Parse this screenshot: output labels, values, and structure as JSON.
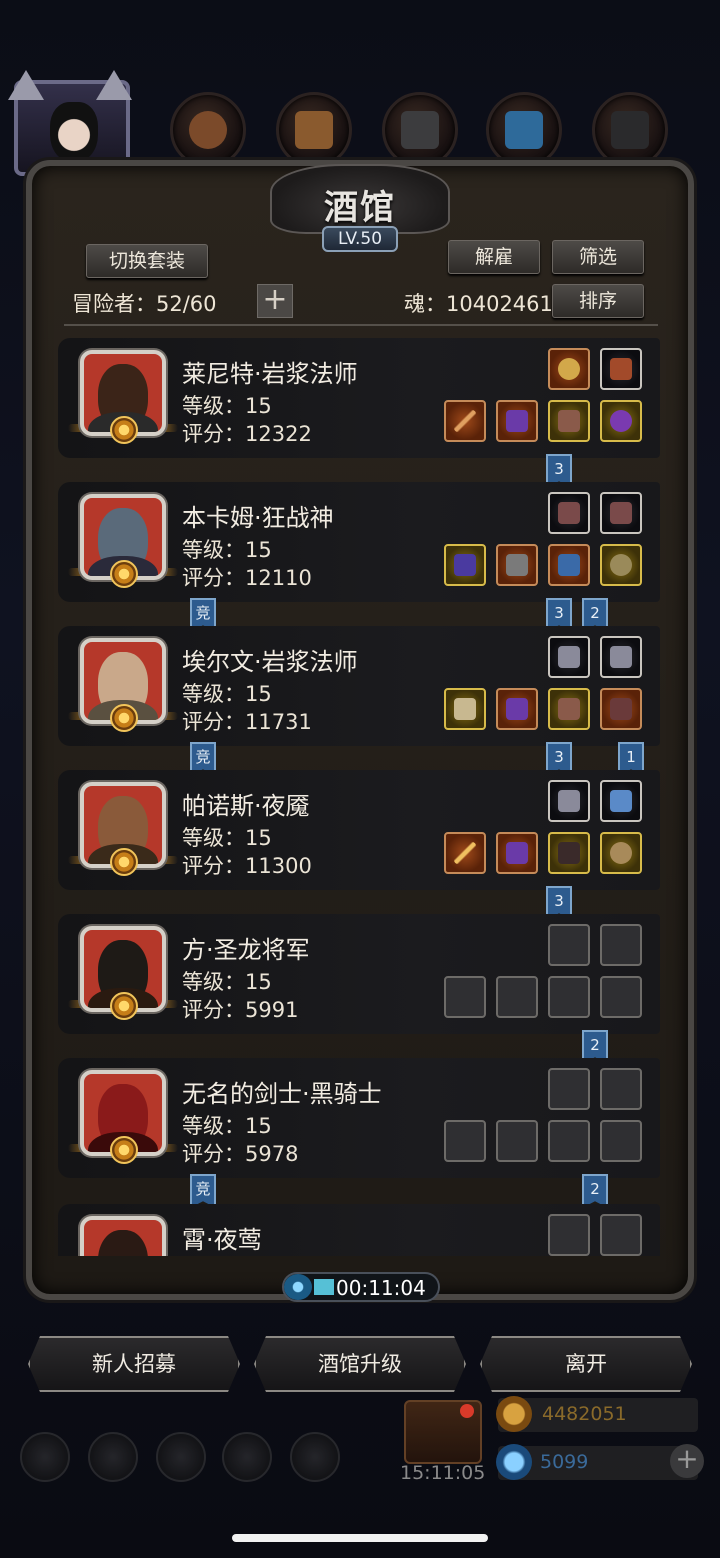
{
  "header": {
    "title": "酒馆",
    "level": "LV.50",
    "switch_outfit_label": "切换套装",
    "dismiss_label": "解雇",
    "filter_label": "筛选",
    "sort_label": "排序",
    "adventurers_label": "冒险者：52/60",
    "soul_label": "魂：10402461"
  },
  "adventurers": [
    {
      "name": "莱尼特·岩浆法师",
      "level": "等级：15",
      "score": "评分：12322"
    },
    {
      "name": "本卡姆·狂战神",
      "level": "等级：15",
      "score": "评分：12110"
    },
    {
      "name": "埃尔文·岩浆法师",
      "level": "等级：15",
      "score": "评分：11731"
    },
    {
      "name": "帕诺斯·夜魇",
      "level": "等级：15",
      "score": "评分：11300"
    },
    {
      "name": "方·圣龙将军",
      "level": "等级：15",
      "score": "评分：5991"
    },
    {
      "name": "无名的剑士·黑骑士",
      "level": "等级：15",
      "score": "评分：5978"
    },
    {
      "name": "霄·夜莺"
    }
  ],
  "tags": {
    "arena": "竞",
    "three": "3",
    "two": "2",
    "one": "1"
  },
  "timer": "00:11:04",
  "buttons": {
    "recruit": "新人招募",
    "upgrade": "酒馆升级",
    "leave": "离开"
  },
  "bottom": {
    "clock": "15:11:05",
    "gold": "4482051",
    "gems": "5099",
    "plus": "+"
  },
  "colors": {
    "panel": "#2a241d",
    "tag_blue": "#2d5b8e",
    "slot_orange": "#a04a1a",
    "slot_gold": "#8a7214"
  }
}
